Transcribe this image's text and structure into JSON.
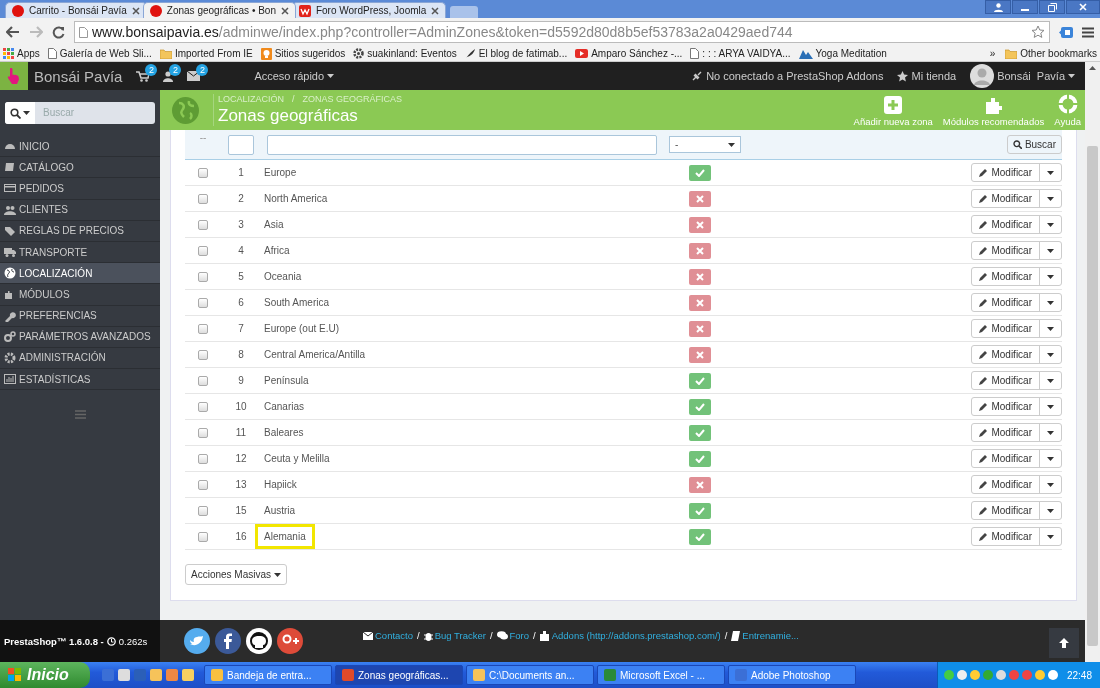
{
  "browser": {
    "tabs": [
      {
        "title": "Carrito - Bonsái Pavía",
        "selected": false
      },
      {
        "title": "Zonas geográficas • Bon",
        "selected": true
      },
      {
        "title": "Foro WordPress, Joomla",
        "selected": false
      }
    ],
    "url": {
      "host": "www.bonsaipavia.es",
      "path": "/adminwe/index.php?controller=AdminZones&token=d5592d80d8b5ef53783a2a0429aed744"
    },
    "bookmarks": [
      {
        "label": "Apps"
      },
      {
        "label": "Galería de Web Sli..."
      },
      {
        "label": "Imported From IE"
      },
      {
        "label": "Sitios sugeridos"
      },
      {
        "label": "suakinland: Eventos"
      },
      {
        "label": "El blog de fatimab..."
      },
      {
        "label": "Amparo Sánchez -..."
      },
      {
        "label": ": : : ARYA VAIDYA..."
      },
      {
        "label": "Yoga Meditation"
      }
    ],
    "overflow": "»",
    "other_bookmarks": "Other bookmarks"
  },
  "admin_bar": {
    "brand": "Bonsái Pavía",
    "badges": [
      "2",
      "2",
      "2"
    ],
    "quick_access": "Acceso rápido",
    "addons": "No conectado a PrestaShop Addons",
    "shop": "Mi tienda",
    "user": "Bonsái  Pavía"
  },
  "sidebar": {
    "search": {
      "placeholder": "Buscar"
    },
    "items": [
      {
        "label": "INICIO",
        "selected": false
      },
      {
        "label": "CATÁLOGO",
        "selected": false
      },
      {
        "label": "PEDIDOS",
        "selected": false
      },
      {
        "label": "CLIENTES",
        "selected": false
      },
      {
        "label": "REGLAS DE PRECIOS",
        "selected": false
      },
      {
        "label": "TRANSPORTE",
        "selected": false
      },
      {
        "label": "LOCALIZACIÓN",
        "selected": true
      },
      {
        "label": "MÓDULOS",
        "selected": false
      },
      {
        "label": "PREFERENCIAS",
        "selected": false
      },
      {
        "label": "PARÁMETROS AVANZADOS",
        "selected": false
      },
      {
        "label": "ADMINISTRACIÓN",
        "selected": false
      },
      {
        "label": "ESTADÍSTICAS",
        "selected": false
      }
    ]
  },
  "page_header": {
    "breadcrumb": [
      {
        "label": "LOCALIZACIÓN",
        "separator": "/"
      },
      {
        "label": "ZONAS GEOGRÁFICAS"
      }
    ],
    "title": "Zonas geográficas",
    "toolbar": [
      {
        "label": "Añadir nueva zona"
      },
      {
        "label": "Módulos recomendados"
      },
      {
        "label": "Ayuda"
      }
    ]
  },
  "filter": {
    "select_all": "--",
    "status_value": "-",
    "button": "Buscar"
  },
  "rows": [
    {
      "id": "1",
      "name": "Europe",
      "enabled": true,
      "checked": false,
      "highlighted": false,
      "action": "Modificar"
    },
    {
      "id": "2",
      "name": "North America",
      "enabled": false,
      "checked": false,
      "highlighted": false,
      "action": "Modificar"
    },
    {
      "id": "3",
      "name": "Asia",
      "enabled": false,
      "checked": false,
      "highlighted": false,
      "action": "Modificar"
    },
    {
      "id": "4",
      "name": "Africa",
      "enabled": false,
      "checked": false,
      "highlighted": false,
      "action": "Modificar"
    },
    {
      "id": "5",
      "name": "Oceania",
      "enabled": false,
      "checked": false,
      "highlighted": false,
      "action": "Modificar"
    },
    {
      "id": "6",
      "name": "South America",
      "enabled": false,
      "checked": false,
      "highlighted": false,
      "action": "Modificar"
    },
    {
      "id": "7",
      "name": "Europe (out E.U)",
      "enabled": false,
      "checked": false,
      "highlighted": false,
      "action": "Modificar"
    },
    {
      "id": "8",
      "name": "Central America/Antilla",
      "enabled": false,
      "checked": false,
      "highlighted": false,
      "action": "Modificar"
    },
    {
      "id": "9",
      "name": "Península",
      "enabled": true,
      "checked": false,
      "highlighted": false,
      "action": "Modificar"
    },
    {
      "id": "10",
      "name": "Canarias",
      "enabled": true,
      "checked": false,
      "highlighted": false,
      "action": "Modificar"
    },
    {
      "id": "11",
      "name": "Baleares",
      "enabled": true,
      "checked": false,
      "highlighted": false,
      "action": "Modificar"
    },
    {
      "id": "12",
      "name": "Ceuta y Melilla",
      "enabled": true,
      "checked": false,
      "highlighted": false,
      "action": "Modificar"
    },
    {
      "id": "13",
      "name": "Hapiick",
      "enabled": false,
      "checked": false,
      "highlighted": false,
      "action": "Modificar"
    },
    {
      "id": "15",
      "name": "Austria",
      "enabled": true,
      "checked": false,
      "highlighted": false,
      "action": "Modificar"
    },
    {
      "id": "16",
      "name": "Alemania",
      "enabled": true,
      "checked": false,
      "highlighted": true,
      "action": "Modificar"
    }
  ],
  "bulk_button": "Acciones Masivas",
  "footer": {
    "version": "PrestaShop™ 1.6.0.8 -",
    "time": "0.262s",
    "links": [
      {
        "label": "Contacto",
        "separator": "/"
      },
      {
        "label": "Bug Tracker",
        "separator": "/"
      },
      {
        "label": "Foro",
        "separator": "/"
      },
      {
        "label": "Addons (http://addons.prestashop.com/)",
        "separator": "/"
      },
      {
        "label": "Entrenamie..."
      }
    ]
  },
  "taskbar": {
    "start": "Inicio",
    "tasks": [
      {
        "label": "Bandeja de entra...",
        "selected": false
      },
      {
        "label": "Zonas geográficas...",
        "selected": true
      },
      {
        "label": "C:\\Documents an...",
        "selected": false
      },
      {
        "label": "Microsoft Excel - ...",
        "selected": false
      },
      {
        "label": "Adobe Photoshop",
        "selected": false
      }
    ],
    "clock": "22:48"
  }
}
